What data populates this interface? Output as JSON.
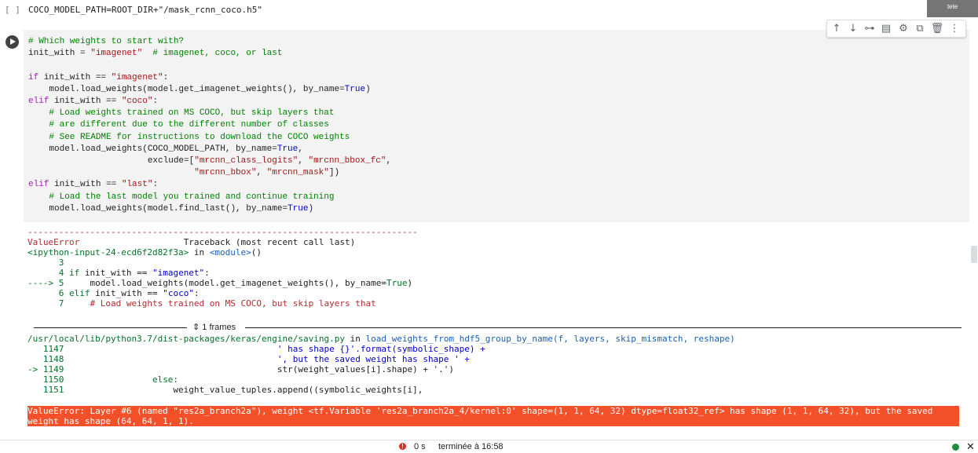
{
  "user_tab": {
    "label": "tete"
  },
  "prev_cell": {
    "bracket": "[ ]",
    "code": "COCO_MODEL_PATH=ROOT_DIR+\"/mask_rcnn_coco.h5\""
  },
  "cell_toolbar": {
    "icons": [
      "arrow-up-icon",
      "arrow-down-icon",
      "link-icon",
      "comment-icon",
      "gear-icon",
      "mirror-icon",
      "delete-icon",
      "more-icon"
    ]
  },
  "code": {
    "l1": "# Which weights to start with?",
    "l2a": "init_with = ",
    "l2b": "\"imagenet\"",
    "l2c": "  # imagenet, coco, or last",
    "l4a": "if",
    "l4b": " init_with == ",
    "l4c": "\"imagenet\"",
    "l4d": ":",
    "l5a": "    model.load_weights(model.get_imagenet_weights(), by_name=",
    "l5b": "True",
    "l5c": ")",
    "l6a": "elif",
    "l6b": " init_with == ",
    "l6c": "\"coco\"",
    "l6d": ":",
    "l7": "    # Load weights trained on MS COCO, but skip layers that",
    "l8": "    # are different due to the different number of classes",
    "l9": "    # See README for instructions to download the COCO weights",
    "l10a": "    model.load_weights(COCO_MODEL_PATH, by_name=",
    "l10b": "True",
    "l10c": ",",
    "l11a": "                       exclude=[",
    "l11b": "\"mrcnn_class_logits\"",
    "l11c": ", ",
    "l11d": "\"mrcnn_bbox_fc\"",
    "l11e": ",",
    "l12a": "                                ",
    "l12b": "\"mrcnn_bbox\"",
    "l12c": ", ",
    "l12d": "\"mrcnn_mask\"",
    "l12e": "])",
    "l13a": "elif",
    "l13b": " init_with == ",
    "l13c": "\"last\"",
    "l13d": ":",
    "l14": "    # Load the last model you trained and continue training",
    "l15a": "    model.load_weights(model.find_last(), by_name=",
    "l15b": "True",
    "l15c": ")"
  },
  "output": {
    "dashes": "---------------------------------------------------------------------------",
    "err_name": "ValueError",
    "traceback_label": "Traceback (most recent call last)",
    "input_ref": "<ipython-input-24-ecd6f2d82f3a>",
    "in_word": " in ",
    "module": "<module>",
    "module_paren": "()",
    "t3": "      3",
    "t4a": "      4 ",
    "t4b": "if",
    "t4c": " init_with == ",
    "t4d": "\"imagenet\"",
    "t4e": ":",
    "t5a": "----> 5",
    "t5b": "     model.load_weights(model.get_imagenet_weights(), by_name=",
    "t5c": "True",
    "t5d": ")",
    "t6a": "      6 ",
    "t6b": "elif",
    "t6c": " init_with == ",
    "t6d": "\"coco\"",
    "t6e": ":",
    "t7a": "      7 ",
    "t7b": "    # Load weights trained on MS COCO, but skip layers that",
    "frames_label": "1 frames",
    "file_path": "/usr/local/lib/python3.7/dist-packages/keras/engine/saving.py",
    "func_name": "load_weights_from_hdf5_group_by_name(f, layers, skip_mismatch, reshape)",
    "f1147a": "   1147",
    "f1147b": "                                         ' has shape {}'.format(symbolic_shape) +",
    "f1148a": "   1148",
    "f1148b": "                                         ', but the saved weight has shape ' +",
    "f1149a": "-> 1149",
    "f1149b": "                                         str(weight_values[i].shape) + '.')",
    "f1150a": "   1150",
    "f1150b": "                 else:",
    "f1151a": "   1151",
    "f1151b": "                     weight_value_tuples.append((symbolic_weights[i],",
    "error_message": "ValueError: Layer #6 (named \"res2a_branch2a\"), weight <tf.Variable 'res2a_branch2a_4/kernel:0' shape=(1, 1, 64, 32) dtype=float32_ref> has shape (1, 1, 64, 32), but the saved weight has shape (64, 64, 1, 1)."
  },
  "status": {
    "time": "0 s",
    "text": "terminée à 16:58",
    "close": "✕"
  }
}
